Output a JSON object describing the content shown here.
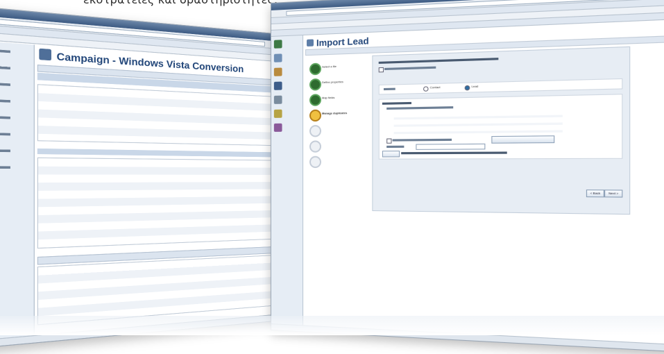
{
  "caption": "εκστρατείες και δραστηριότητες.",
  "left_window": {
    "form_title": "Campaign - Windows Vista Conversion",
    "nav_items": [
      "",
      "",
      "",
      "",
      "",
      "",
      "",
      "",
      ""
    ]
  },
  "right_window": {
    "page_title": "Import Lead",
    "wizard_steps": [
      "Select a file",
      "Define properties",
      "Map fields",
      "Manage duplicates",
      "",
      "",
      ""
    ],
    "radio_labels": [
      "Contact",
      "Lead"
    ],
    "buttons": {
      "back": "< Back",
      "next": "Next >"
    }
  }
}
